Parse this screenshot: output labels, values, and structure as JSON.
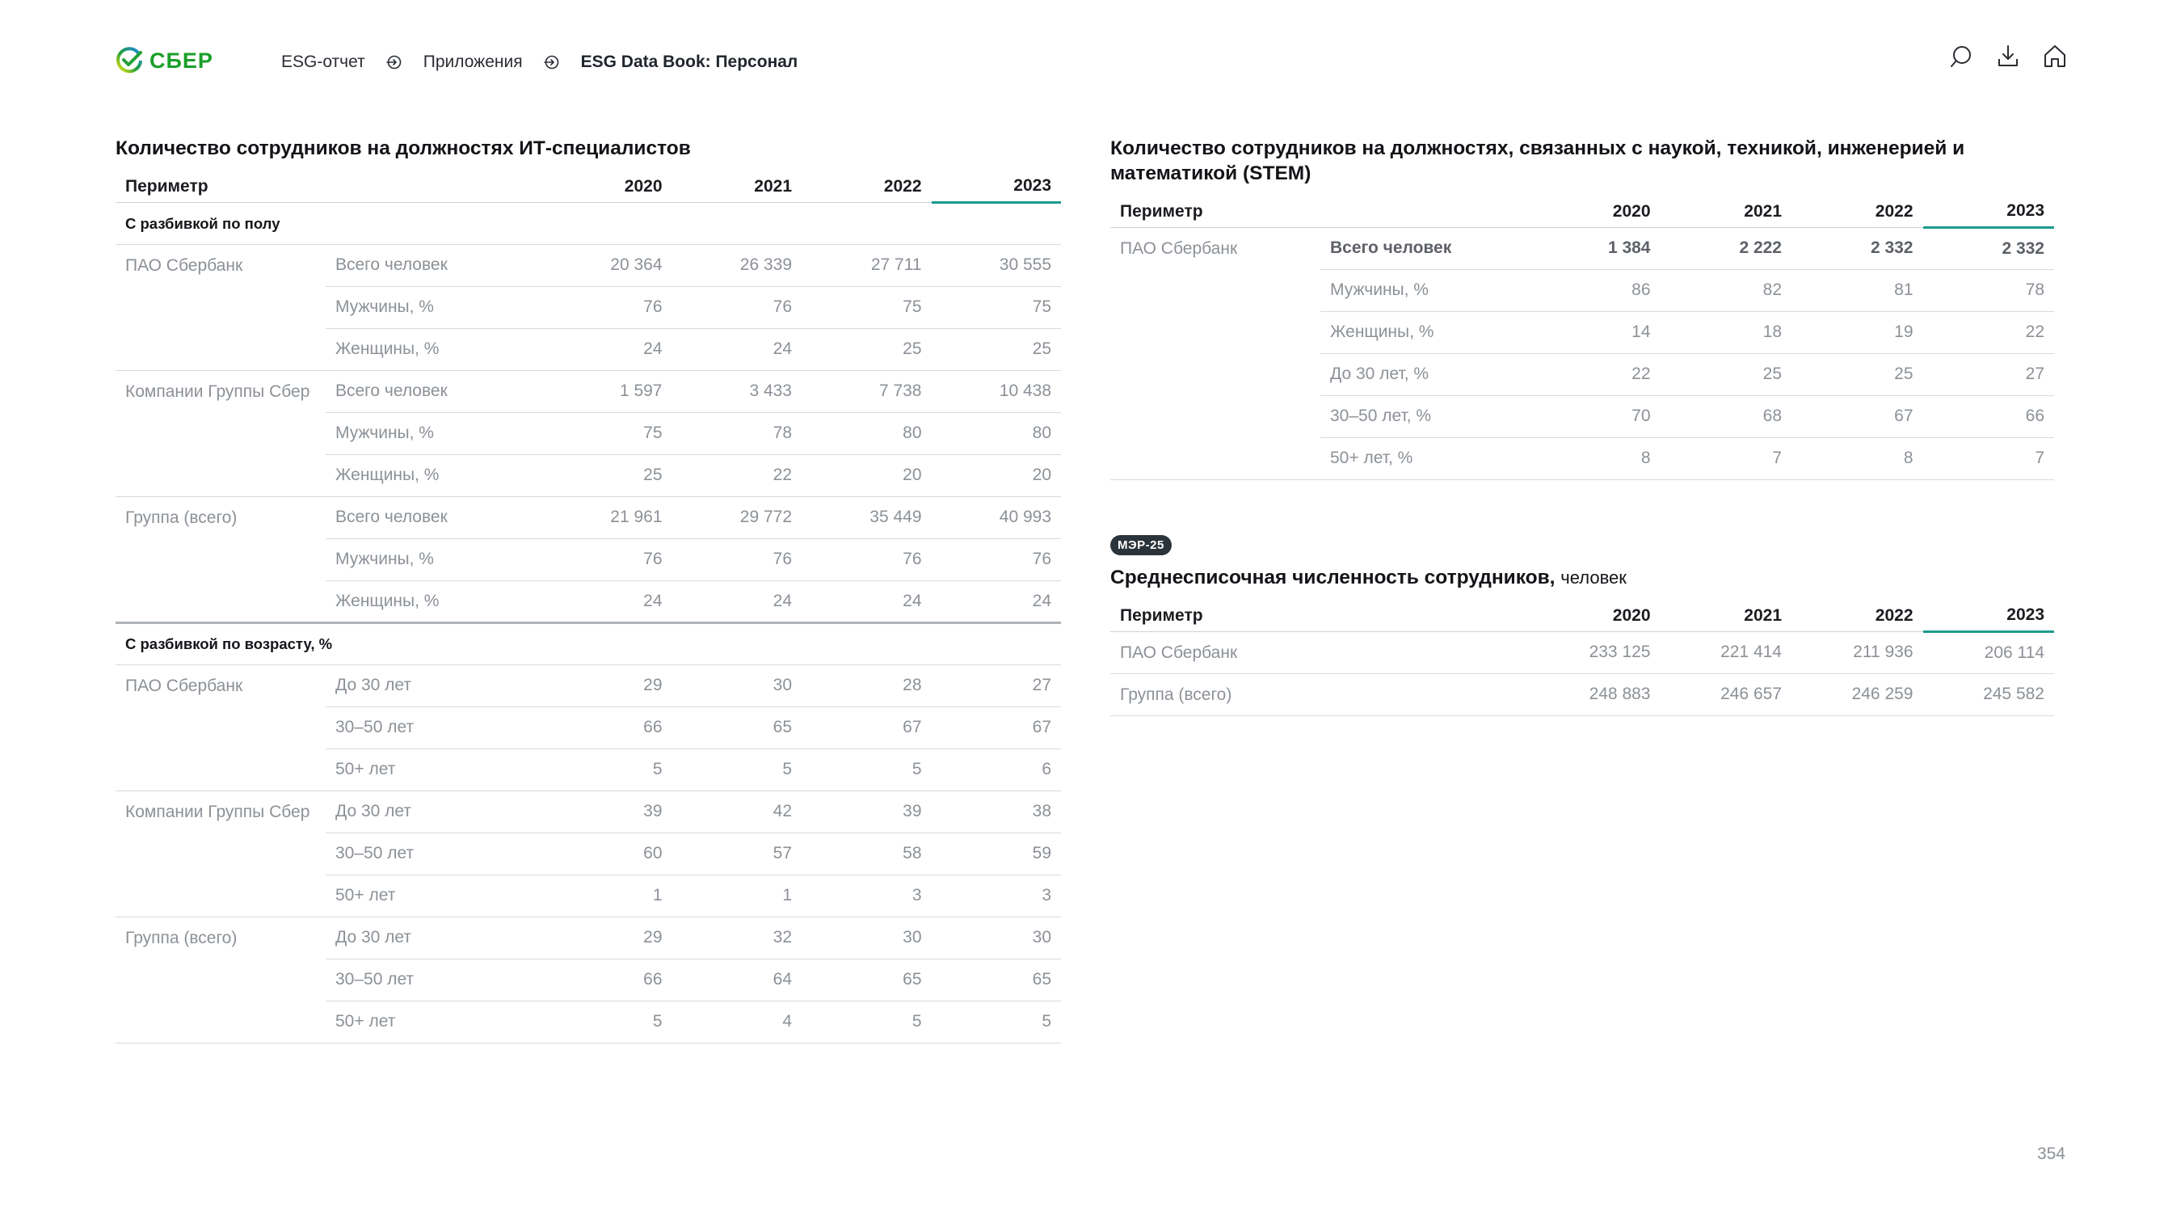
{
  "header": {
    "logo_text": "СБЕР",
    "brand_color": "#1a9f29",
    "breadcrumb": [
      "ESG-отчет",
      "Приложения",
      "ESG Data Book: Персонал"
    ],
    "icons": [
      "search-icon",
      "download-icon",
      "home-icon"
    ]
  },
  "it_table": {
    "title": "Количество сотрудников на должностях ИТ-специалистов",
    "columns": [
      "Периметр",
      "2020",
      "2021",
      "2022",
      "2023"
    ],
    "gender_heading": "С разбивкой по полу",
    "gender_groups": [
      {
        "name": "ПАО Сбербанк",
        "rows": [
          {
            "label": "Всего человек",
            "values": [
              "20 364",
              "26 339",
              "27 711",
              "30 555"
            ]
          },
          {
            "label": "Мужчины, %",
            "values": [
              "76",
              "76",
              "75",
              "75"
            ]
          },
          {
            "label": "Женщины, %",
            "values": [
              "24",
              "24",
              "25",
              "25"
            ]
          }
        ]
      },
      {
        "name": "Компании Группы Сбер",
        "rows": [
          {
            "label": "Всего человек",
            "values": [
              "1 597",
              "3 433",
              "7 738",
              "10 438"
            ]
          },
          {
            "label": "Мужчины, %",
            "values": [
              "75",
              "78",
              "80",
              "80"
            ]
          },
          {
            "label": "Женщины, %",
            "values": [
              "25",
              "22",
              "20",
              "20"
            ]
          }
        ]
      },
      {
        "name": "Группа (всего)",
        "rows": [
          {
            "label": "Всего человек",
            "values": [
              "21 961",
              "29 772",
              "35 449",
              "40 993"
            ]
          },
          {
            "label": "Мужчины, %",
            "values": [
              "76",
              "76",
              "76",
              "76"
            ]
          },
          {
            "label": "Женщины, %",
            "values": [
              "24",
              "24",
              "24",
              "24"
            ]
          }
        ]
      }
    ],
    "age_heading": "С разбивкой по возрасту, %",
    "age_groups": [
      {
        "name": "ПАО Сбербанк",
        "rows": [
          {
            "label": "До 30 лет",
            "values": [
              "29",
              "30",
              "28",
              "27"
            ]
          },
          {
            "label": "30–50 лет",
            "values": [
              "66",
              "65",
              "67",
              "67"
            ]
          },
          {
            "label": "50+ лет",
            "values": [
              "5",
              "5",
              "5",
              "6"
            ]
          }
        ]
      },
      {
        "name": "Компании Группы Сбер",
        "rows": [
          {
            "label": "До 30 лет",
            "values": [
              "39",
              "42",
              "39",
              "38"
            ]
          },
          {
            "label": "30–50 лет",
            "values": [
              "60",
              "57",
              "58",
              "59"
            ]
          },
          {
            "label": "50+ лет",
            "values": [
              "1",
              "1",
              "3",
              "3"
            ]
          }
        ]
      },
      {
        "name": "Группа (всего)",
        "rows": [
          {
            "label": "До 30 лет",
            "values": [
              "29",
              "32",
              "30",
              "30"
            ]
          },
          {
            "label": "30–50 лет",
            "values": [
              "66",
              "64",
              "65",
              "65"
            ]
          },
          {
            "label": "50+ лет",
            "values": [
              "5",
              "4",
              "5",
              "5"
            ]
          }
        ]
      }
    ]
  },
  "stem_table": {
    "title": "Количество сотрудников на должностях, связанных с наукой, техникой, инженерией и математикой (STEM)",
    "columns": [
      "Периметр",
      "2020",
      "2021",
      "2022",
      "2023"
    ],
    "groups": [
      {
        "name": "ПАО Сбербанк",
        "rows": [
          {
            "label": "Всего человек",
            "values": [
              "1 384",
              "2 222",
              "2 332",
              "2 332"
            ],
            "bold": true
          },
          {
            "label": "Мужчины, %",
            "values": [
              "86",
              "82",
              "81",
              "78"
            ]
          },
          {
            "label": "Женщины, %",
            "values": [
              "14",
              "18",
              "19",
              "22"
            ]
          },
          {
            "label": "До 30 лет, %",
            "values": [
              "22",
              "25",
              "25",
              "27"
            ]
          },
          {
            "label": "30–50 лет, %",
            "values": [
              "70",
              "68",
              "67",
              "66"
            ]
          },
          {
            "label": "50+ лет, %",
            "values": [
              "8",
              "7",
              "8",
              "7"
            ]
          }
        ]
      }
    ]
  },
  "headcount_table": {
    "badge": "МЭР-25",
    "title": "Среднесписочная численность сотрудников,",
    "title_unit": "человек",
    "columns": [
      "Периметр",
      "2020",
      "2021",
      "2022",
      "2023"
    ],
    "rows": [
      {
        "label": "ПАО Сбербанк",
        "values": [
          "233 125",
          "221 414",
          "211 936",
          "206 114"
        ]
      },
      {
        "label": "Группа (всего)",
        "values": [
          "248 883",
          "246 657",
          "246 259",
          "245 582"
        ]
      }
    ]
  },
  "page_number": "354",
  "colors": {
    "accent": "#1d9a8f",
    "muted_text": "#8c9197",
    "badge_bg": "#2b343b"
  }
}
